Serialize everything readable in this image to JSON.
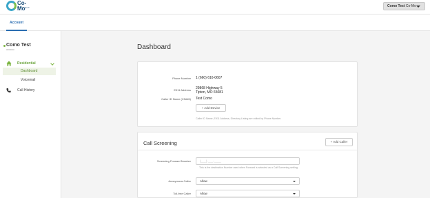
{
  "brand": {
    "name": "Co-Mo",
    "tagline": "CONNECT",
    "primary_color": "#3aa6c9",
    "accent_color": "#7cc04b"
  },
  "user_menu": {
    "name": "Como Test",
    "account": "Co-Mo"
  },
  "tabs": [
    {
      "label": "Account",
      "active": true
    }
  ],
  "sidebar": {
    "account_name": "Como Test",
    "account_number": "0000000",
    "items": [
      {
        "label": "Residential",
        "icon": "home-icon",
        "expanded": true
      },
      {
        "label": "Dashboard",
        "active": true
      },
      {
        "label": "Voicemail"
      },
      {
        "label": "Call History",
        "icon": "phone-icon"
      }
    ]
  },
  "main": {
    "title": "Dashboard",
    "details": {
      "phone_label": "Phone Number",
      "phone_value": "1 (660) 616-0607",
      "e911_label": "E911 Address",
      "e911_line1": "29868 Highway 5",
      "e911_line2": "Tipton, MO 65081",
      "cnam_label": "Caller ID Name (CNAM)",
      "cnam_value": "Test Como",
      "add_device": "+ Add Device",
      "note": "Caller ID Name, E911 Address, Directory Listing are edited by Phone Number."
    },
    "screening": {
      "title": "Call Screening",
      "add_caller": "+ Add Caller",
      "forward_label": "Screening Forward Number",
      "forward_placeholder": "(___) ___-____",
      "forward_note": "This is the destination Number used when Forward is selected as a Call Screening setting.",
      "anon_label": "Anonymous Caller",
      "anon_value": "Allow",
      "tollfree_label": "Toll-free Caller",
      "tollfree_value": "Allow"
    }
  }
}
